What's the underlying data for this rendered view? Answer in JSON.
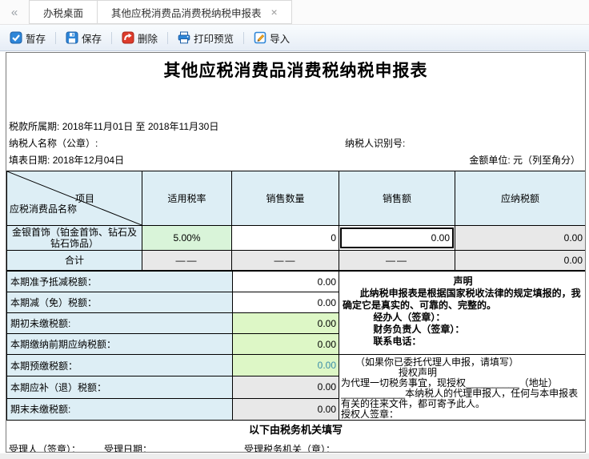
{
  "tabs": {
    "collapse_icon": "«",
    "close_icon": "×",
    "items": [
      {
        "label": "办税桌面"
      },
      {
        "label": "其他应税消费品消费税纳税申报表"
      }
    ]
  },
  "toolbar": {
    "buttons": [
      {
        "label": "暂存",
        "icon": "tempsave-check-icon"
      },
      {
        "label": "保存",
        "icon": "save-floppy-icon"
      },
      {
        "label": "删除",
        "icon": "delete-undo-icon"
      },
      {
        "label": "打印预览",
        "icon": "print-preview-icon"
      },
      {
        "label": "导入",
        "icon": "import-pencil-icon"
      }
    ]
  },
  "form": {
    "title": "其他应税消费品消费税纳税申报表",
    "period_label": "税款所属期:",
    "period_value": "2018年11月01日 至 2018年11月30日",
    "taxpayer_name_label": "纳税人名称（公章）:",
    "taxpayer_id_label": "纳税人识别号:",
    "fill_date_label": "填表日期:",
    "fill_date_value": "2018年12月04日",
    "amount_unit": "金额单位: 元（列至角分）"
  },
  "main_table": {
    "corner_top": "项目",
    "corner_bottom": "应税消费品名称",
    "columns": [
      "适用税率",
      "销售数量",
      "销售额",
      "应纳税额"
    ],
    "rows": [
      {
        "name": "金银首饰（铂金首饰、钻石及钻石饰品）",
        "tax_rate": "5.00%",
        "quantity": "0",
        "sales": "0.00",
        "tax_due": "0.00"
      },
      {
        "name": "合计",
        "tax_rate": "——",
        "quantity": "——",
        "sales": "——",
        "tax_due": "0.00"
      }
    ]
  },
  "summary_rows": [
    {
      "label": "本期准予抵减税额：",
      "value": "0.00"
    },
    {
      "label": "本期减（免）税额：",
      "value": "0.00"
    },
    {
      "label": "期初未缴税额:",
      "value": "0.00"
    },
    {
      "label": "本期缴纳前期应纳税额：",
      "value": "0.00"
    },
    {
      "label": "本期预缴税额：",
      "value": "0.00"
    },
    {
      "label": "本期应补（退）税额：",
      "value": "0.00"
    },
    {
      "label": "期末未缴税额:",
      "value": "0.00"
    }
  ],
  "declaration": {
    "title": "声明",
    "body": "此纳税申报表是根据国家税收法律的规定填报的，我确定它是真实的、可靠的、完整的。",
    "agent_label": "经办人（签章）：",
    "finance_label": "财务负责人（签章）：",
    "phone_label": "联系电话："
  },
  "authorization": {
    "hint": "（如果你已委托代理人申报，请填写）",
    "title": "授权声明",
    "body_line1": "为代理一切税务事宜，现授权__________（地址）",
    "body_line2": "____________本纳税人的代理申报人，任何与本申报表有关的往来文件，都可寄予此人。",
    "sign_label": "授权人签章："
  },
  "footer": {
    "title": "以下由税务机关填写",
    "acceptor_label": "受理人（签章）：",
    "accept_date_label": "受理日期：",
    "accept_org_label": "受理税务机关（章）："
  },
  "colors": {
    "accent_blue": "#2e86d8",
    "delete_red": "#dd3b2b",
    "header_cell_blue": "#ddeef5",
    "rate_green": "#d9f4d9",
    "value_green": "#ddf7c6",
    "readonly_gray": "#e8e8e8",
    "teal_value": "#3a8ca8"
  }
}
